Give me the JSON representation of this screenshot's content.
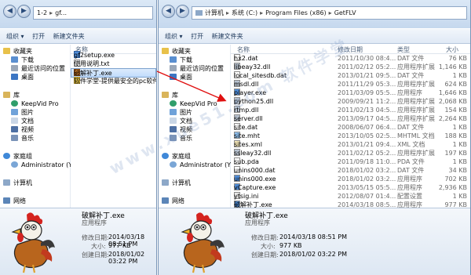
{
  "left": {
    "address": [
      "1-2",
      "gf..."
    ],
    "toolbar": [
      "组织 ▾",
      "打开",
      "新建文件夹"
    ],
    "col_name": "名称",
    "nav": [
      "收藏夹",
      "下载",
      "最近访问的位置",
      "桌面",
      "库",
      "KeepVid Pro",
      "图片",
      "文档",
      "视频",
      "音乐",
      "家庭组",
      "Administrator (YTC",
      "计算机",
      "网络"
    ],
    "files": [
      "gf2setup.exe",
      "使用说明.txt",
      "破解补丁.exe",
      "软件学堂-提供最安全的pc软件_免"
    ],
    "details": {
      "name": "破解补丁.exe",
      "type": "应用程序",
      "modified_label": "修改日期:",
      "modified": "2014/03/18 08:51 PM",
      "size_label": "大小:",
      "size": "977 KB",
      "created_label": "创建日期:",
      "created": "2018/01/02 03:22 PM"
    }
  },
  "right": {
    "address": [
      "计算机",
      "系统 (C:)",
      "Program Files (x86)",
      "GetFLV"
    ],
    "toolbar": [
      "组织 ▾",
      "打开",
      "新建文件夹"
    ],
    "nav": [
      "收藏夹",
      "下载",
      "最近访问的位置",
      "桌面",
      "库",
      "KeepVid Pro",
      "图片",
      "文档",
      "视频",
      "音乐",
      "家庭组",
      "Administrator (YTC",
      "计算机",
      "网络"
    ],
    "columns": [
      "名称",
      "修改日期",
      "类型",
      "大小"
    ],
    "files": [
      {
        "name": "hx2.dat",
        "date": "2011/10/30 08:4...",
        "type": "DAT 文件",
        "size": "76 KB"
      },
      {
        "name": "libeay32.dll",
        "date": "2011/02/12 05:2...",
        "type": "应用程序扩展",
        "size": "1,146 KB"
      },
      {
        "name": "local_sitesdb.dat",
        "date": "2013/01/21 09:5...",
        "type": "DAT 文件",
        "size": "1 KB"
      },
      {
        "name": "msdl.dll",
        "date": "2011/11/29 05:3...",
        "type": "应用程序扩展",
        "size": "624 KB"
      },
      {
        "name": "player.exe",
        "date": "2011/03/09 05:5...",
        "type": "应用程序",
        "size": "1,646 KB"
      },
      {
        "name": "python25.dll",
        "date": "2009/09/21 11:2...",
        "type": "应用程序扩展",
        "size": "2,068 KB"
      },
      {
        "name": "rtmp.dll",
        "date": "2011/02/13 04:5...",
        "type": "应用程序扩展",
        "size": "154 KB"
      },
      {
        "name": "server.dll",
        "date": "2013/09/17 04:5...",
        "type": "应用程序扩展",
        "size": "2,264 KB"
      },
      {
        "name": "site.dat",
        "date": "2008/06/07 06:4...",
        "type": "DAT 文件",
        "size": "1 KB"
      },
      {
        "name": "site.mht",
        "date": "2013/10/05 02:5...",
        "type": "MHTML 文档",
        "size": "188 KB"
      },
      {
        "name": "sites.xml",
        "date": "2013/01/21 09:4...",
        "type": "XML 文档",
        "size": "1 KB"
      },
      {
        "name": "ssleay32.dll",
        "date": "2011/02/12 05:2...",
        "type": "应用程序扩展",
        "size": "197 KB"
      },
      {
        "name": "sub.pda",
        "date": "2011/09/18 11:0...",
        "type": "PDA 文件",
        "size": "1 KB"
      },
      {
        "name": "unins000.dat",
        "date": "2018/01/02 03:2...",
        "type": "DAT 文件",
        "size": "34 KB"
      },
      {
        "name": "unins000.exe",
        "date": "2018/01/02 03:2...",
        "type": "应用程序",
        "size": "702 KB"
      },
      {
        "name": "vCapture.exe",
        "date": "2013/05/15 05:5...",
        "type": "应用程序",
        "size": "2,936 KB"
      },
      {
        "name": "ytsig.ini",
        "date": "2012/08/07 01:4...",
        "type": "配置设置",
        "size": "1 KB"
      },
      {
        "name": "破解补丁.exe",
        "date": "2014/03/18 08:5...",
        "type": "应用程序",
        "size": "977 KB"
      }
    ],
    "details": {
      "name": "破解补丁.exe",
      "type": "应用程序",
      "modified_label": "修改日期:",
      "modified": "2014/03/18 08:51 PM",
      "size_label": "大小:",
      "size": "977 KB",
      "created_label": "创建日期:",
      "created": "2018/01/02 03:22 PM"
    }
  },
  "watermark": "www.xue51.com 软件学堂",
  "colors": {
    "toolbar_text": "#1e395b",
    "selection": "#c1dcfc",
    "arrow": "#e01010"
  }
}
